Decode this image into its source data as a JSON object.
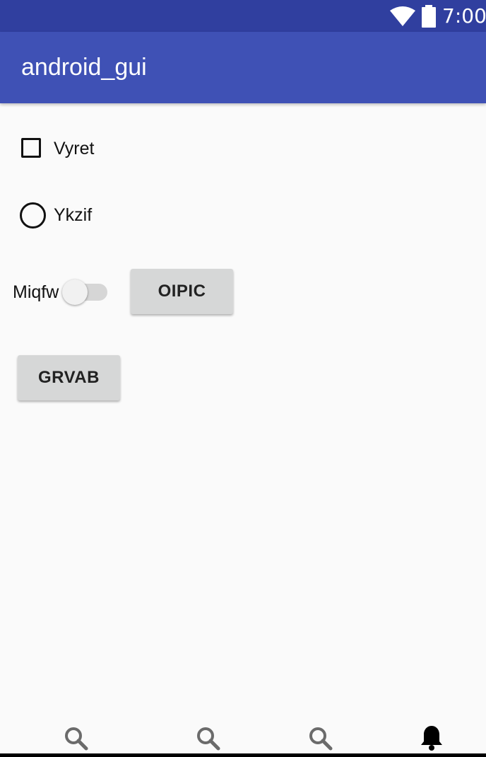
{
  "status_bar": {
    "time": "7:00",
    "icons": [
      "wifi-icon",
      "battery-icon"
    ],
    "color": "#303f9f"
  },
  "app_bar": {
    "title": "android_gui",
    "color": "#3f51b5"
  },
  "checkbox": {
    "label": "Vyret",
    "checked": false
  },
  "radio": {
    "label": "Ykzif",
    "selected": false
  },
  "switch": {
    "label": "Miqfw",
    "on": false
  },
  "buttons": {
    "oipic_label": "OIPIC",
    "grvab_label": "GRVAB"
  },
  "bottom_nav": {
    "items": [
      {
        "icon": "search-icon"
      },
      {
        "icon": "search-icon"
      },
      {
        "icon": "search-icon"
      },
      {
        "icon": "bell-icon"
      }
    ]
  }
}
